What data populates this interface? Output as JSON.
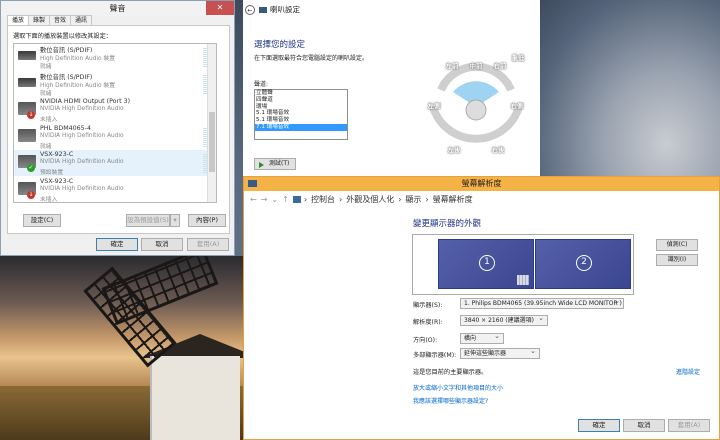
{
  "sound": {
    "title": "聲音",
    "tabs": [
      "播放",
      "錄製",
      "音效",
      "通訊"
    ],
    "instruction": "選取下面的播放裝置以修改其設定：",
    "devices": [
      {
        "name": "數位音訊 (S/PDIF)",
        "driver": "High Definition Audio 裝置",
        "status": "就緒",
        "icon": "spdif-icon",
        "badge": ""
      },
      {
        "name": "數位音訊 (S/PDIF)",
        "driver": "High Definition Audio 裝置",
        "status": "就緒",
        "icon": "spdif-icon",
        "badge": ""
      },
      {
        "name": "NVIDIA HDMI Output (Port 3)",
        "driver": "NVIDIA High Definition Audio",
        "status": "未插入",
        "icon": "monitor-icon",
        "badge": "red"
      },
      {
        "name": "PHL BDM4065-4",
        "driver": "NVIDIA High Definition Audio",
        "status": "就緒",
        "icon": "monitor-icon",
        "badge": ""
      },
      {
        "name": "VSX-923-C",
        "driver": "NVIDIA High Definition Audio",
        "status": "預設裝置",
        "icon": "monitor-icon",
        "badge": "green"
      },
      {
        "name": "VSX-923-C",
        "driver": "NVIDIA High Definition Audio",
        "status": "未插入",
        "icon": "monitor-icon",
        "badge": "red"
      }
    ],
    "configure": "設定(C)",
    "set_default": "設為預設值(S)",
    "properties": "內容(P)",
    "ok": "確定",
    "cancel": "取消",
    "apply": "套用(A)"
  },
  "speaker": {
    "title": "喇叭設定",
    "heading": "選擇您的設定",
    "subtitle": "在下面選取最符合您電腦設定的喇叭設定。",
    "channels_label": "聲道:",
    "channels": [
      "立體聲",
      "四聲道",
      "環場",
      "5.1 環場音效",
      "5.1 環場音效",
      "7.1 環場音效"
    ],
    "selected_index": 5,
    "test": "測試(T)",
    "speakers": [
      "左前",
      "中前",
      "右前",
      "重低",
      "左側",
      "右側",
      "左後",
      "右後"
    ]
  },
  "display": {
    "title": "螢幕解析度",
    "breadcrumb": [
      "控制台",
      "外觀及個人化",
      "顯示",
      "螢幕解析度"
    ],
    "heading": "變更顯示器的外觀",
    "monitors": [
      "1",
      "2"
    ],
    "detect": "偵測(C)",
    "identify": "識別(I)",
    "display_label": "顯示器(S):",
    "display_value": "1. Philips BDM4065 (39.95inch Wide LCD MONITOR )",
    "resolution_label": "解析度(R):",
    "resolution_value": "3840 × 2160 (建議選項)",
    "orientation_label": "方向(O):",
    "orientation_value": "橫向",
    "multi_label": "多部顯示器(M):",
    "multi_value": "延伸這些顯示器",
    "main_display_text": "這是您目前的主要顯示器。",
    "advanced_link": "進階設定",
    "link1": "放大或縮小文字和其他項目的大小",
    "link2": "我應該選擇哪些顯示器設定?",
    "ok": "確定",
    "cancel": "取消",
    "apply": "套用(A)"
  },
  "colors": {
    "accent_orange": "#f5b247",
    "heading_blue": "#1e3287",
    "link_blue": "#0066cc",
    "selection": "#3399ff"
  }
}
